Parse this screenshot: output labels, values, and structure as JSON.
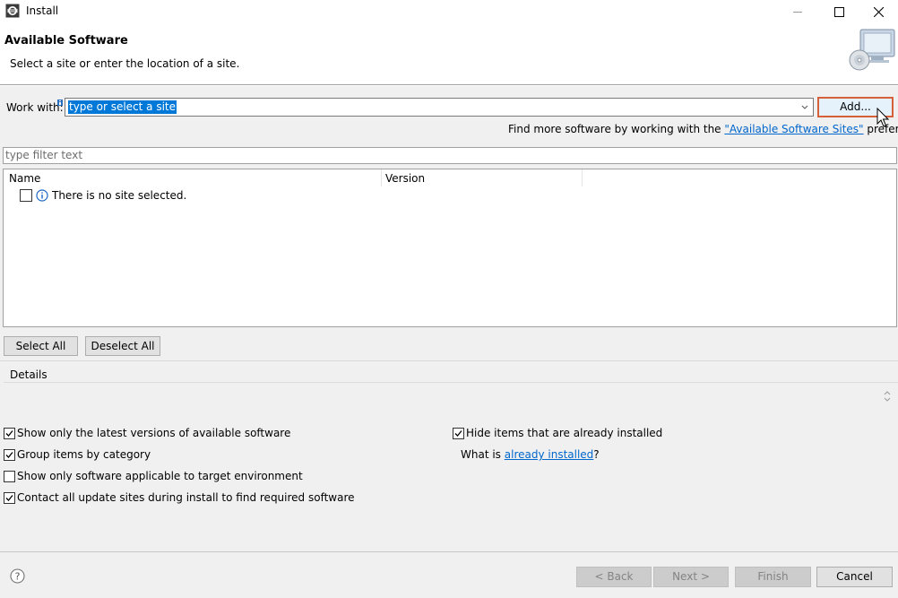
{
  "window": {
    "title": "Install"
  },
  "header": {
    "title": "Available Software",
    "message": "Select a site or enter the location of a site."
  },
  "work_with": {
    "label": "Work with:",
    "value": "type or select a site",
    "add_label": "Add...",
    "find_more_prefix": "Find more software by working with the ",
    "find_more_link": "\"Available Software Sites\"",
    "find_more_suffix": " preferences."
  },
  "filter": {
    "placeholder": "type filter text"
  },
  "table": {
    "columns": [
      "Name",
      "Version"
    ],
    "rows": [
      {
        "name": "There is no site selected.",
        "checked": false
      }
    ]
  },
  "selection_buttons": {
    "select_all": "Select All",
    "deselect_all": "Deselect All"
  },
  "details": {
    "label": "Details"
  },
  "options": {
    "latest_versions": {
      "label": "Show only the latest versions of available software",
      "checked": true
    },
    "group_by_category": {
      "label": "Group items by category",
      "checked": true
    },
    "target_env": {
      "label": "Show only software applicable to target environment",
      "checked": false
    },
    "contact_sites": {
      "label": "Contact all update sites during install to find required software",
      "checked": true
    },
    "hide_installed": {
      "label": "Hide items that are already installed",
      "checked": true
    },
    "what_is_prefix": "What is ",
    "what_is_link": "already installed",
    "what_is_suffix": "?"
  },
  "footer": {
    "back_label": "< Back",
    "next_label": "Next >",
    "finish_label": "Finish",
    "cancel_label": "Cancel"
  },
  "colors": {
    "accent_border": "#d5603a",
    "selection": "#0078d7",
    "link": "#0066cc"
  }
}
